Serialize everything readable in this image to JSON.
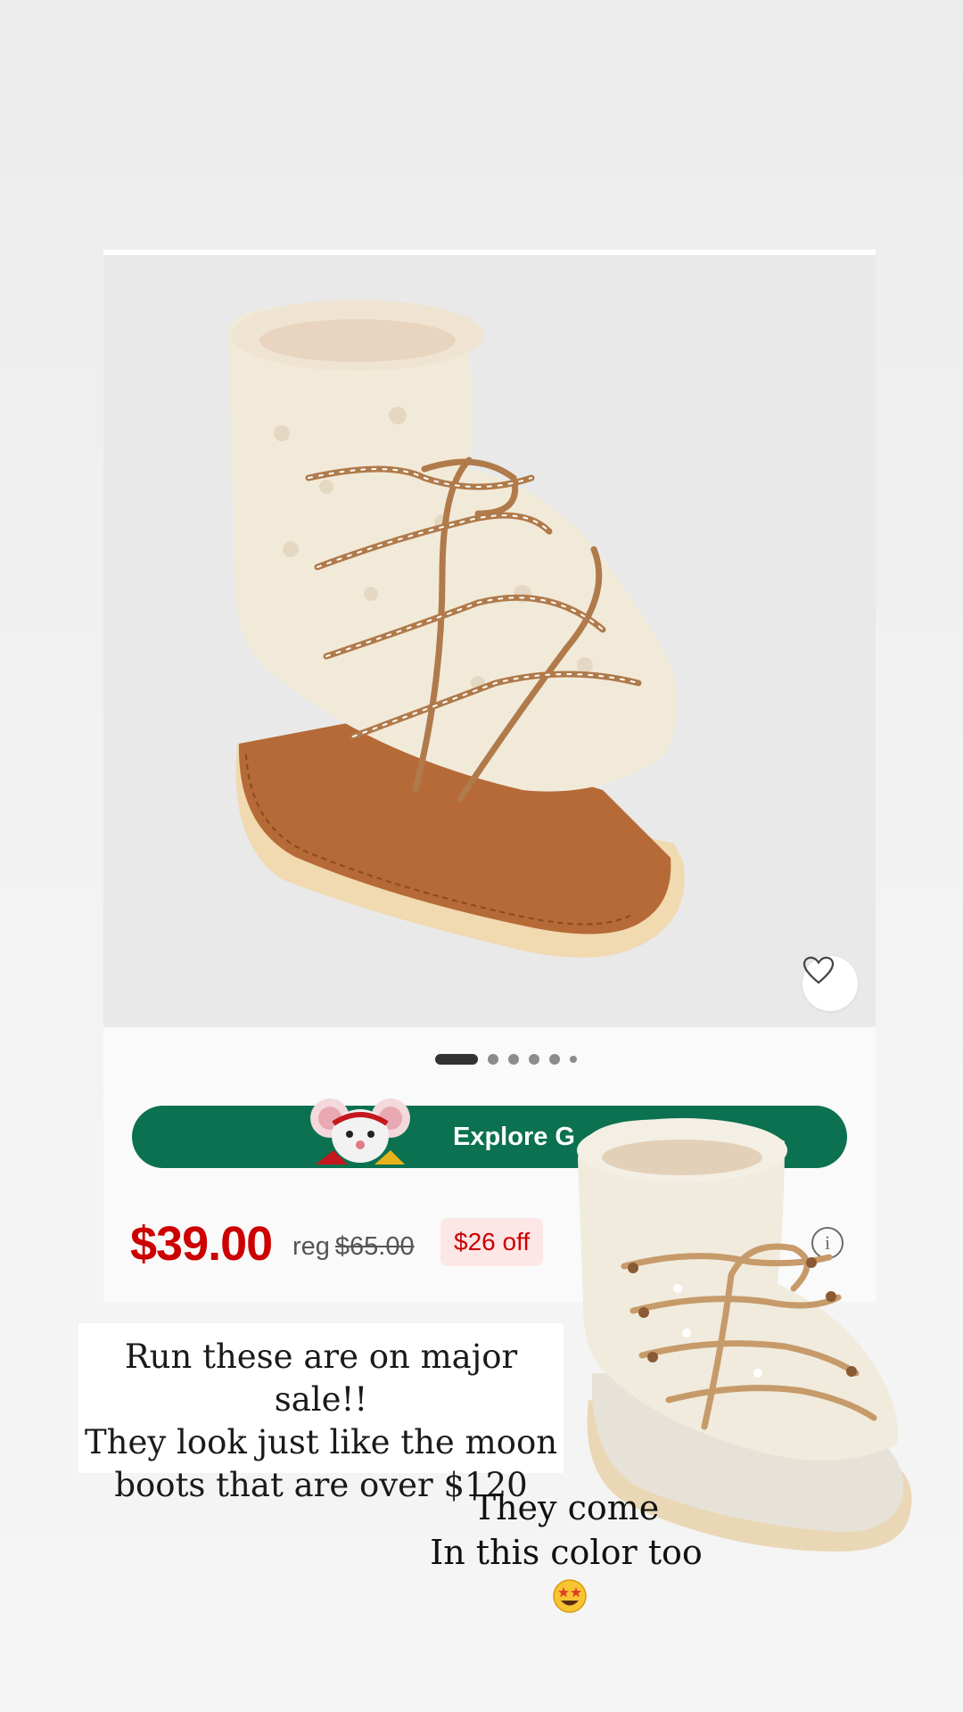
{
  "product_card": {
    "promo": {
      "label": "Explore G"
    },
    "price": {
      "sale": "$39.00",
      "reg_prefix": "reg",
      "reg_value": "$65.00",
      "discount_badge": "$26 off"
    },
    "carousel": {
      "total": 6,
      "active_index": 0
    },
    "icons": {
      "favorite": "heart-icon",
      "info": "info-icon"
    },
    "info_glyph": "i"
  },
  "story": {
    "caption_lines": [
      "Run these are on major sale!!",
      "They look just like the moon",
      "boots that are over $120"
    ],
    "color_note_lines": [
      "They come",
      "In this color too"
    ],
    "emoji": "star-struck-emoji"
  },
  "colors": {
    "price_red": "#cc0000",
    "promo_green": "#0b7150",
    "badge_bg": "#fde6e6"
  }
}
